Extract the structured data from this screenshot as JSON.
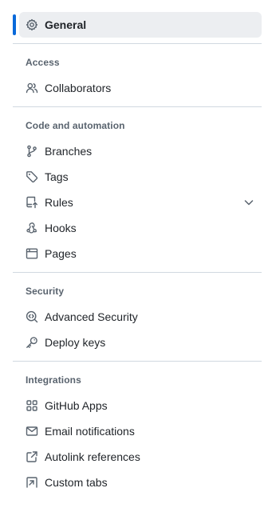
{
  "sidebar": {
    "general": {
      "label": "General",
      "icon": "gear-icon"
    },
    "groups": [
      {
        "title": "Access",
        "items": [
          {
            "label": "Collaborators",
            "icon": "people-icon"
          }
        ]
      },
      {
        "title": "Code and automation",
        "items": [
          {
            "label": "Branches",
            "icon": "git-branch-icon"
          },
          {
            "label": "Tags",
            "icon": "tag-icon"
          },
          {
            "label": "Rules",
            "icon": "repo-push-icon",
            "expandable": true
          },
          {
            "label": "Hooks",
            "icon": "webhook-icon"
          },
          {
            "label": "Pages",
            "icon": "browser-icon"
          }
        ]
      },
      {
        "title": "Security",
        "items": [
          {
            "label": "Advanced Security",
            "icon": "codescan-icon"
          },
          {
            "label": "Deploy keys",
            "icon": "key-icon"
          }
        ]
      },
      {
        "title": "Integrations",
        "items": [
          {
            "label": "GitHub Apps",
            "icon": "apps-icon"
          },
          {
            "label": "Email notifications",
            "icon": "mail-icon"
          },
          {
            "label": "Autolink references",
            "icon": "link-external-icon"
          },
          {
            "label": "Custom tabs",
            "icon": "arrow-up-right-box-icon"
          }
        ]
      }
    ]
  },
  "colors": {
    "accent": "#0969da",
    "active_bg": "#eceef1",
    "muted_text": "#59636e",
    "divider": "#d1d9e0"
  }
}
